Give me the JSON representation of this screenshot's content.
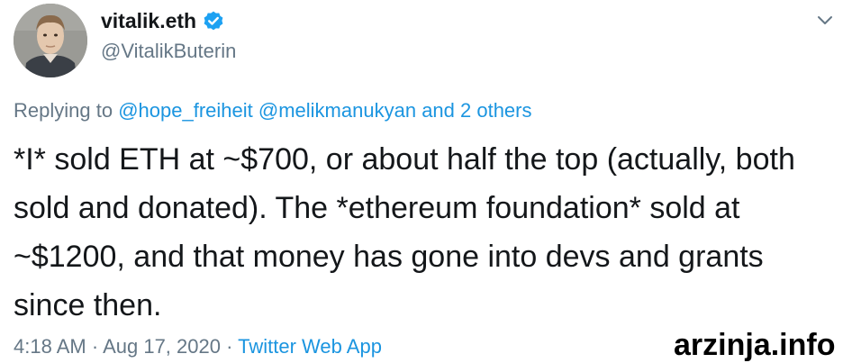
{
  "author": {
    "display_name": "vitalik.eth",
    "handle": "@VitalikButerin",
    "verified": true,
    "avatar": "profile-photo"
  },
  "menu": {
    "icon": "chevron-down-icon"
  },
  "reply": {
    "prefix": "Replying to",
    "mention_1": "@hope_freiheit",
    "mention_2": "@melikmanukyan",
    "others": "and 2 others"
  },
  "tweet": {
    "text": "*I* sold ETH at ~$700, or about half the top (actually, both sold and donated). The *ethereum foundation* sold at ~$1200, and that money has gone into devs and grants since then."
  },
  "meta": {
    "time": "4:18 AM",
    "separator_1": "·",
    "date": "Aug 17, 2020",
    "separator_2": "·",
    "app": "Twitter Web App"
  },
  "watermark": "arzinja.info",
  "colors": {
    "text": "#14171a",
    "secondary": "#657786",
    "link": "#1b95e0",
    "verified": "#1da1f2"
  }
}
